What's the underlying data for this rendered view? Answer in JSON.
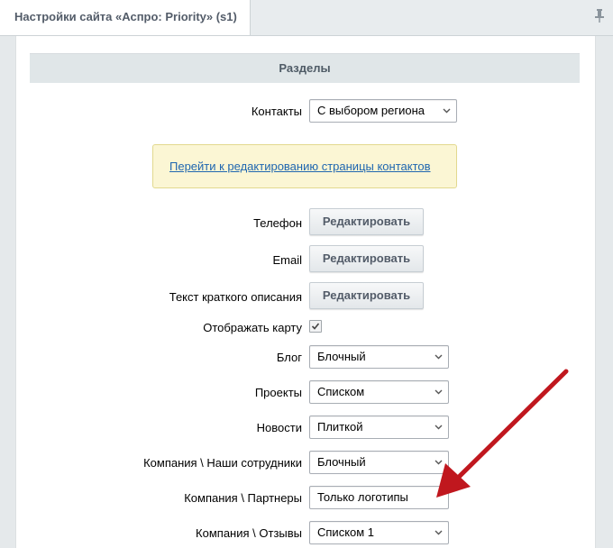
{
  "tab": {
    "title": "Настройки сайта «Аспро: Priority» (s1)"
  },
  "section": {
    "title": "Разделы"
  },
  "contacts": {
    "label": "Контакты",
    "value": "С выбором региона"
  },
  "notice": {
    "link": "Перейти к редактированию страницы контактов"
  },
  "edit_rows": [
    {
      "label": "Телефон",
      "button": "Редактировать"
    },
    {
      "label": "Email",
      "button": "Редактировать"
    },
    {
      "label": "Текст краткого описания",
      "button": "Редактировать"
    }
  ],
  "show_map": {
    "label": "Отображать карту",
    "checked": true
  },
  "selects": [
    {
      "label": "Блог",
      "value": "Блочный"
    },
    {
      "label": "Проекты",
      "value": "Списком"
    },
    {
      "label": "Новости",
      "value": "Плиткой"
    },
    {
      "label": "Компания \\ Наши сотрудники",
      "value": "Блочный"
    },
    {
      "label": "Компания \\ Партнеры",
      "value": "Только логотипы"
    },
    {
      "label": "Компания \\ Отзывы",
      "value": "Списком 1"
    }
  ],
  "colors": {
    "arrow": "#c0171e",
    "link": "#2067b0",
    "notice_bg": "#fbf6d4"
  },
  "icons": {
    "pin": "pin-icon",
    "chevron": "chevron-down-icon",
    "check": "check-icon"
  }
}
